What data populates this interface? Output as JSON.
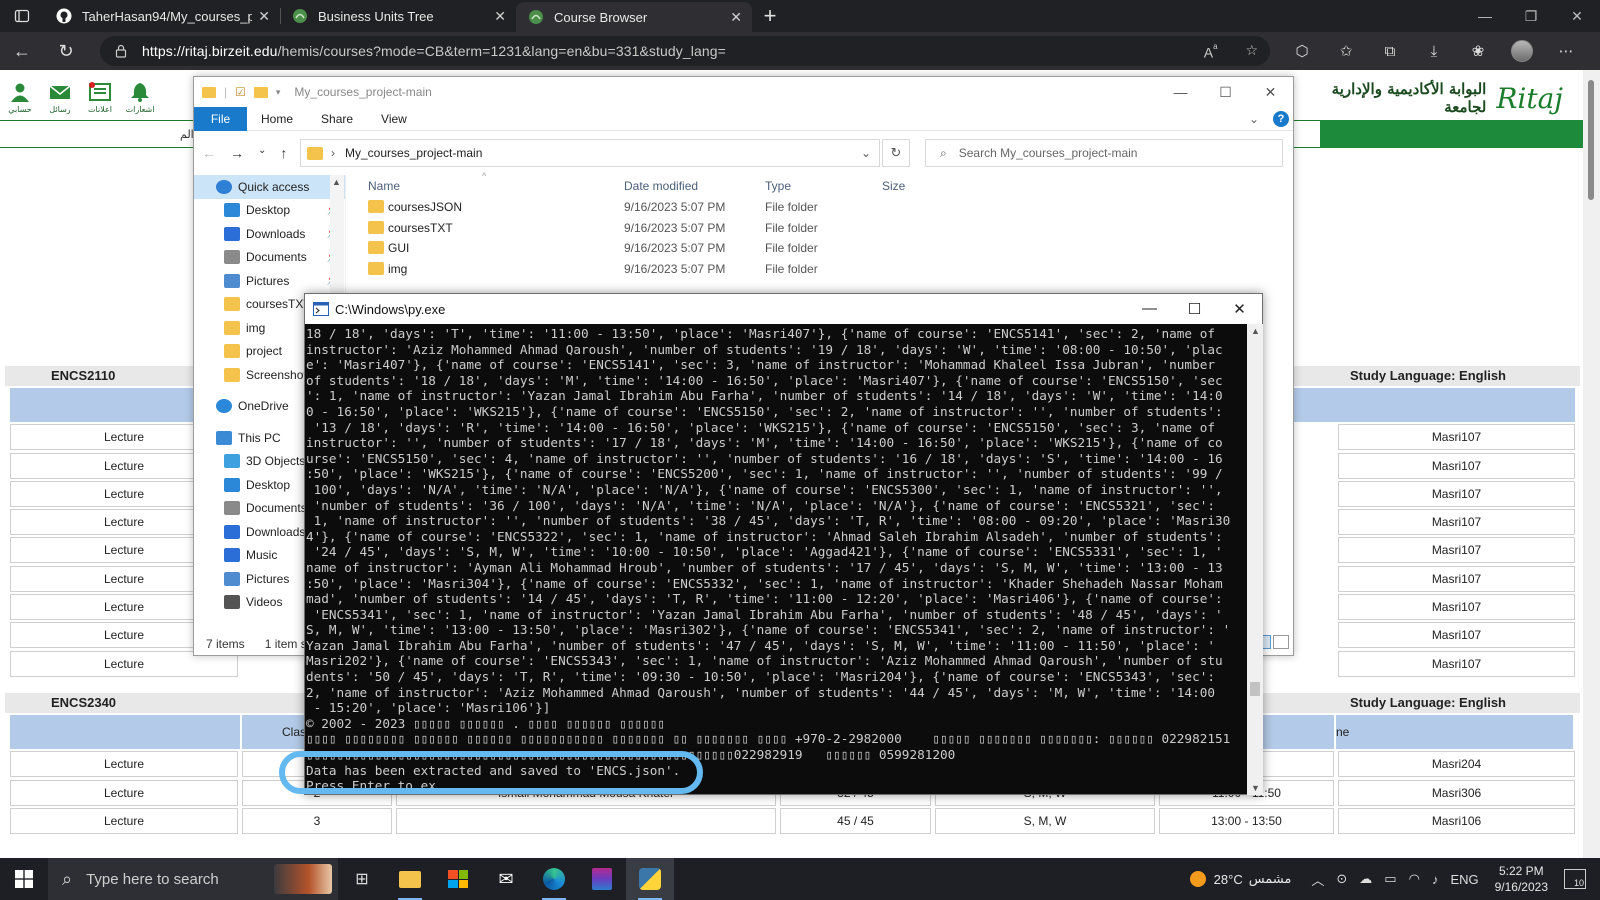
{
  "browser": {
    "tabs": [
      {
        "title": "TaherHasan94/My_courses_proje",
        "icon": "github-icon",
        "active": false
      },
      {
        "title": "Business Units Tree",
        "icon": "ritaj-icon",
        "active": false
      },
      {
        "title": "Course Browser",
        "icon": "ritaj-icon",
        "active": true
      }
    ],
    "url_host": "https://ritaj.birzeit.edu",
    "url_path": "/hemis/courses?mode=CB&term=1231&lang=en&bu=331&study_lang=",
    "new_tab": "+"
  },
  "ritaj": {
    "brand_arabic": "البوابة الأكاديمية والإدارية لجامعة",
    "logo_text": "Ritaj",
    "toplinks": [
      {
        "label": "حسابي",
        "icon": "account-icon"
      },
      {
        "label": "رسائل",
        "icon": "mail-icon"
      },
      {
        "label": "اعلانات",
        "icon": "announcements-icon"
      },
      {
        "label": "اشعارات",
        "icon": "bell-icon"
      }
    ],
    "left_strip_text": "الم",
    "sections": [
      {
        "code": "ENCS2110",
        "lang": "Study Language: English",
        "rows": [
          {
            "type": "Lecture",
            "room": "Masri107"
          },
          {
            "type": "Lecture",
            "room": "Masri107"
          },
          {
            "type": "Lecture",
            "room": "Masri107"
          },
          {
            "type": "Lecture",
            "room": "Masri107"
          },
          {
            "type": "Lecture",
            "room": "Masri107"
          },
          {
            "type": "Lecture",
            "room": "Masri107"
          },
          {
            "type": "Lecture",
            "room": "Masri107"
          },
          {
            "type": "Lecture",
            "room": "Masri107"
          },
          {
            "type": "Lecture",
            "room": "Masri107"
          }
        ]
      },
      {
        "code": "ENCS2340",
        "lang": "Study Language: English",
        "head_class": "Clas",
        "head_time": "ne",
        "rows": [
          {
            "type": "Lecture",
            "sec": "",
            "instructor": "",
            "students": "",
            "days": "",
            "time": "",
            "room": "Masri204"
          },
          {
            "type": "Lecture",
            "sec": "2",
            "instructor": "Ismail Mohammad Mousa Khater",
            "students": "32 / 45",
            "days": "S, M, W",
            "time": "11:00 - 11:50",
            "room": "Masri306"
          },
          {
            "type": "Lecture",
            "sec": "3",
            "instructor": "",
            "students": "45 / 45",
            "days": "S, M, W",
            "time": "13:00 - 13:50",
            "room": "Masri106"
          }
        ]
      }
    ]
  },
  "explorer": {
    "title": "My_courses_project-main",
    "ribbon": {
      "file": "File",
      "tabs": [
        "Home",
        "Share",
        "View"
      ]
    },
    "address": "My_courses_project-main",
    "search_placeholder": "Search My_courses_project-main",
    "nav": [
      {
        "label": "Quick access",
        "icon": "star-icon",
        "pinned": false,
        "selected": true,
        "indent": 0
      },
      {
        "label": "Desktop",
        "icon": "desktop-icon",
        "pinned": true,
        "indent": 1
      },
      {
        "label": "Downloads",
        "icon": "download-icon",
        "pinned": true,
        "indent": 1
      },
      {
        "label": "Documents",
        "icon": "documents-icon",
        "pinned": true,
        "indent": 1
      },
      {
        "label": "Pictures",
        "icon": "pictures-icon",
        "pinned": true,
        "indent": 1
      },
      {
        "label": "coursesTXT",
        "icon": "folder-icon",
        "pinned": false,
        "indent": 1
      },
      {
        "label": "img",
        "icon": "folder-icon",
        "pinned": false,
        "indent": 1
      },
      {
        "label": "project",
        "icon": "folder-icon",
        "pinned": false,
        "indent": 1
      },
      {
        "label": "Screenshots",
        "icon": "folder-icon",
        "pinned": false,
        "indent": 1
      },
      {
        "label": "",
        "icon": "",
        "spacer": true
      },
      {
        "label": "OneDrive",
        "icon": "cloud-icon",
        "pinned": false,
        "indent": 0
      },
      {
        "label": "",
        "icon": "",
        "spacer": true
      },
      {
        "label": "This PC",
        "icon": "pc-icon",
        "pinned": false,
        "indent": 0
      },
      {
        "label": "3D Objects",
        "icon": "3d-objects-icon",
        "pinned": false,
        "indent": 1
      },
      {
        "label": "Desktop",
        "icon": "desktop-icon",
        "pinned": false,
        "indent": 1
      },
      {
        "label": "Documents",
        "icon": "documents-icon",
        "pinned": false,
        "indent": 1
      },
      {
        "label": "Downloads",
        "icon": "download-icon",
        "pinned": false,
        "indent": 1
      },
      {
        "label": "Music",
        "icon": "music-icon",
        "pinned": false,
        "indent": 1
      },
      {
        "label": "Pictures",
        "icon": "pictures-icon",
        "pinned": false,
        "indent": 1
      },
      {
        "label": "Videos",
        "icon": "videos-icon",
        "pinned": false,
        "indent": 1
      }
    ],
    "columns": [
      "Name",
      "Date modified",
      "Type",
      "Size"
    ],
    "files": [
      {
        "name": "coursesJSON",
        "date": "9/16/2023 5:07 PM",
        "type": "File folder",
        "size": ""
      },
      {
        "name": "coursesTXT",
        "date": "9/16/2023 5:07 PM",
        "type": "File folder",
        "size": ""
      },
      {
        "name": "GUI",
        "date": "9/16/2023 5:07 PM",
        "type": "File folder",
        "size": ""
      },
      {
        "name": "img",
        "date": "9/16/2023 5:07 PM",
        "type": "File folder",
        "size": ""
      }
    ],
    "status": {
      "items": "7 items",
      "selected": "1 item s"
    }
  },
  "console": {
    "title": "C:\\Windows\\py.exe",
    "lines": [
      "18 / 18', 'days': 'T', 'time': '11:00 - 13:50', 'place': 'Masri407'}, {'name of course': 'ENCS5141', 'sec': 2, 'name of",
      "instructor': 'Aziz Mohammed Ahmad Qaroush', 'number of students': '19 / 18', 'days': 'W', 'time': '08:00 - 10:50', 'plac",
      "e': 'Masri407'}, {'name of course': 'ENCS5141', 'sec': 3, 'name of instructor': 'Mohammad Khaleel Issa Jubran', 'number",
      "of students': '18 / 18', 'days': 'M', 'time': '14:00 - 16:50', 'place': 'Masri407'}, {'name of course': 'ENCS5150', 'sec",
      "': 1, 'name of instructor': 'Yazan Jamal Ibrahim Abu Farha', 'number of students': '14 / 18', 'days': 'W', 'time': '14:0",
      "0 - 16:50', 'place': 'WKS215'}, {'name of course': 'ENCS5150', 'sec': 2, 'name of instructor': '', 'number of students':",
      " '13 / 18', 'days': 'R', 'time': '14:00 - 16:50', 'place': 'WKS215'}, {'name of course': 'ENCS5150', 'sec': 3, 'name of",
      "instructor': '', 'number of students': '17 / 18', 'days': 'M', 'time': '14:00 - 16:50', 'place': 'WKS215'}, {'name of co",
      "urse': 'ENCS5150', 'sec': 4, 'name of instructor': '', 'number of students': '16 / 18', 'days': 'S', 'time': '14:00 - 16",
      ":50', 'place': 'WKS215'}, {'name of course': 'ENCS5200', 'sec': 1, 'name of instructor': '', 'number of students': '99 /",
      " 100', 'days': 'N/A', 'time': 'N/A', 'place': 'N/A'}, {'name of course': 'ENCS5300', 'sec': 1, 'name of instructor': '',",
      " 'number of students': '36 / 100', 'days': 'N/A', 'time': 'N/A', 'place': 'N/A'}, {'name of course': 'ENCS5321', 'sec':",
      " 1, 'name of instructor': '', 'number of students': '38 / 45', 'days': 'T, R', 'time': '08:00 - 09:20', 'place': 'Masri30",
      "4'}, {'name of course': 'ENCS5322', 'sec': 1, 'name of instructor': 'Ahmad Saleh Ibrahim Alsadeh', 'number of students':",
      " '24 / 45', 'days': 'S, M, W', 'time': '10:00 - 10:50', 'place': 'Aggad421'}, {'name of course': 'ENCS5331', 'sec': 1, '",
      "name of instructor': 'Ayman Ali Mohammad Hroub', 'number of students': '17 / 45', 'days': 'S, M, W', 'time': '13:00 - 13",
      ":50', 'place': 'Masri304'}, {'name of course': 'ENCS5332', 'sec': 1, 'name of instructor': 'Khader Shehadeh Nassar Moham",
      "mad', 'number of students': '14 / 45', 'days': 'T, R', 'time': '11:00 - 12:20', 'place': 'Masri406'}, {'name of course':",
      " 'ENCS5341', 'sec': 1, 'name of instructor': 'Yazan Jamal Ibrahim Abu Farha', 'number of students': '48 / 45', 'days': '",
      "S, M, W', 'time': '13:00 - 13:50', 'place': 'Masri302'}, {'name of course': 'ENCS5341', 'sec': 2, 'name of instructor': '",
      "Yazan Jamal Ibrahim Abu Farha', 'number of students': '47 / 45', 'days': 'S, M, W', 'time': '11:00 - 11:50', 'place': '",
      "Masri202'}, {'name of course': 'ENCS5343', 'sec': 1, 'name of instructor': 'Aziz Mohammed Ahmad Qaroush', 'number of stu",
      "dents': '50 / 45', 'days': 'T, R', 'time': '09:30 - 10:50', 'place': 'Masri204'}, {'name of course': 'ENCS5343', 'sec':",
      "2, 'name of instructor': 'Aziz Mohammed Ahmad Qaroush', 'number of students': '44 / 45', 'days': 'M, W', 'time': '14:00",
      " - 15:20', 'place': 'Masri106'}]",
      "© 2002 - 2023 ▯▯▯▯▯ ▯▯▯▯▯▯ . ▯▯▯▯ ▯▯▯▯▯▯ ▯▯▯▯▯▯",
      "▯▯▯▯ ▯▯▯▯▯▯▯▯ ▯▯▯▯▯▯ ▯▯▯▯▯▯ ▯▯▯▯▯▯▯▯▯▯▯ ▯▯▯▯▯▯▯ ▯▯ ▯▯▯▯▯▯▯ ▯▯▯▯ +970-2-2982000    ▯▯▯▯▯ ▯▯▯▯▯▯▯ ▯▯▯▯▯▯▯: ▯▯▯▯▯▯ 022982151",
      "▯▯▯▯▯▯▯▯▯▯▯▯▯▯▯▯▯▯▯▯▯▯▯▯▯▯▯▯▯▯▯▯▯▯▯▯▯▯▯▯▯▯▯▯▯▯▯▯▯▯▯▯▯▯▯▯022982919   ▯▯▯▯▯▯ 0599281200",
      "Data has been extracted and saved to 'ENCS.json'.",
      "Press Enter to ex"
    ]
  },
  "taskbar": {
    "search_placeholder": "Type here to search",
    "weather_temp": "28°C",
    "weather_text": "مشمس",
    "lang": "ENG",
    "time": "5:22 PM",
    "date": "9/16/2023",
    "notif_count": "10"
  }
}
